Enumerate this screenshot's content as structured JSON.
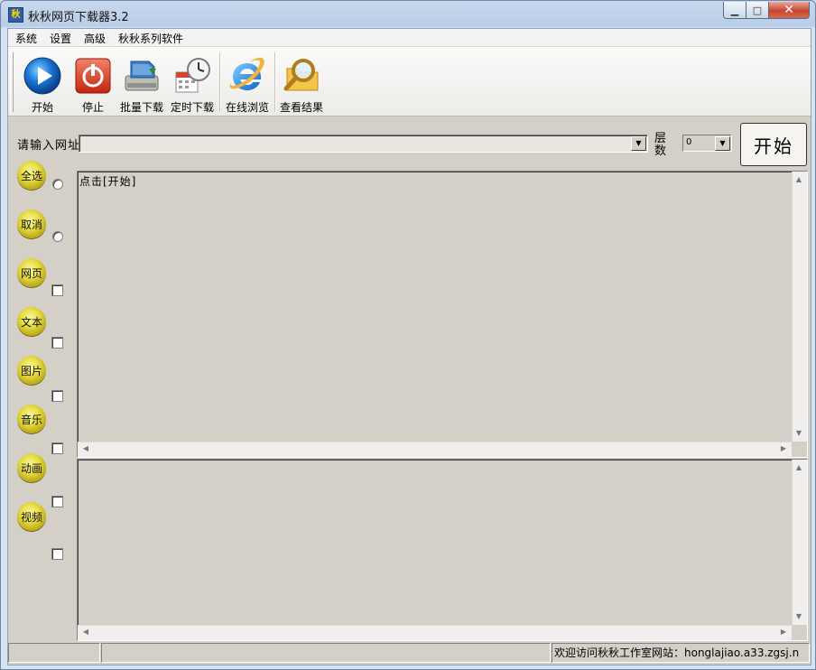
{
  "window": {
    "title": "秋秋网页下载器3.2",
    "minimize_label": "▁",
    "maximize_label": "□",
    "close_label": "✕"
  },
  "menu": [
    "系统",
    "设置",
    "高级",
    "秋秋系列软件"
  ],
  "toolbar": [
    {
      "label": "开始",
      "icon": "play-icon"
    },
    {
      "label": "停止",
      "icon": "power-stop-icon"
    },
    {
      "label": "批量下载",
      "icon": "batch-download-icon"
    },
    {
      "label": "定时下载",
      "icon": "scheduled-download-icon"
    },
    {
      "label": "在线浏览",
      "icon": "internet-explorer-icon"
    },
    {
      "label": "查看结果",
      "icon": "magnifier-folder-icon"
    }
  ],
  "url": {
    "label": "请输入网址",
    "value": ""
  },
  "layer": {
    "label": "层数",
    "value": "0"
  },
  "start_button": "开始",
  "filters": [
    {
      "label": "全选",
      "control": "radio"
    },
    {
      "label": "取消",
      "control": "radio"
    },
    {
      "label": "网页",
      "control": "checkbox"
    },
    {
      "label": "文本",
      "control": "checkbox"
    },
    {
      "label": "图片",
      "control": "checkbox"
    },
    {
      "label": "音乐",
      "control": "checkbox"
    },
    {
      "label": "动画",
      "control": "checkbox"
    },
    {
      "label": "视频",
      "control": "checkbox"
    }
  ],
  "log": {
    "text": "点击[开始]"
  },
  "status": {
    "panel1": "",
    "panel2": "",
    "panel3": "欢迎访问秋秋工作室网站：honglajiao.a33.zgsj.n"
  },
  "colors": {
    "face": "#d4d0c8",
    "title_bar": "#c8d9ee",
    "close_button": "#c8452f",
    "button_gold": "#e9e04a"
  }
}
